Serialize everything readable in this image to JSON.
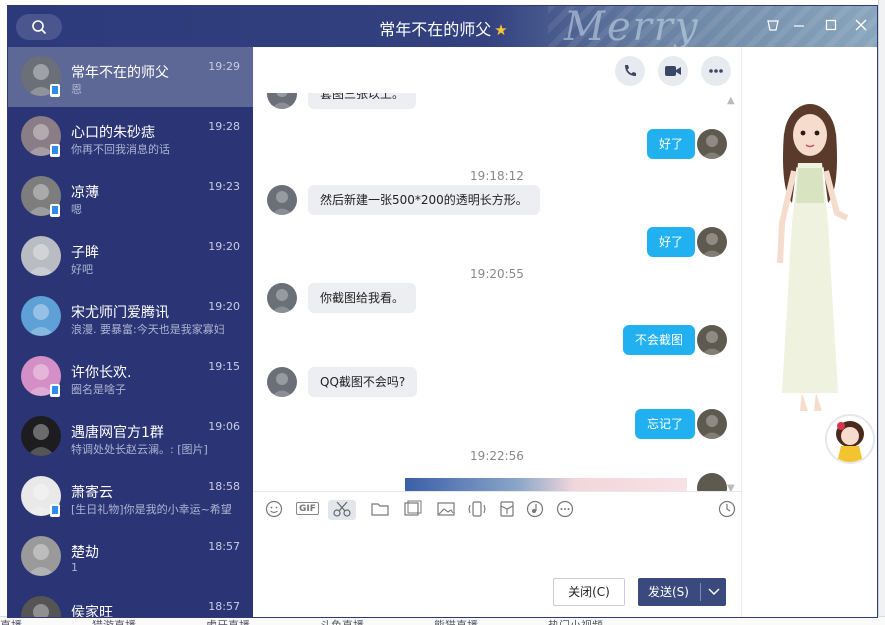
{
  "window": {
    "title": "常年不在的师父",
    "title_deco": "Merry"
  },
  "background": {
    "bottom_text": [
      "直播",
      "猎游直播",
      "虎牙直播",
      "斗鱼直播",
      "熊猫直播",
      "热门小视频"
    ]
  },
  "contacts": [
    {
      "name": "常年不在的师父",
      "time": "19:29",
      "msg": "恩",
      "phone": true,
      "active": true,
      "avatar_color": "#6b6f78"
    },
    {
      "name": "心口的朱砂痣",
      "time": "19:28",
      "msg": "你再不回我消息的话",
      "phone": true,
      "active": false,
      "avatar_color": "#8a7d86"
    },
    {
      "name": "凉薄",
      "time": "19:23",
      "msg": "嗯",
      "phone": true,
      "active": false,
      "avatar_color": "#7d7d7d"
    },
    {
      "name": "子眸",
      "time": "19:20",
      "msg": "好吧",
      "phone": false,
      "active": false,
      "avatar_color": "#b9bcc2"
    },
    {
      "name": "宋尤师门爱腾讯",
      "time": "19:20",
      "msg": "浪漫. 要暴富:今天也是我家寡妇",
      "phone": false,
      "active": false,
      "avatar_color": "#5fa0d6"
    },
    {
      "name": "许你长欢.",
      "time": "19:15",
      "msg": "圈名是啥子",
      "phone": true,
      "active": false,
      "avatar_color": "#d58fc7"
    },
    {
      "name": "遇唐网官方1群",
      "time": "19:06",
      "msg": "特调处处长赵云澜。: [图片]",
      "phone": false,
      "active": false,
      "avatar_color": "#1d1d1f"
    },
    {
      "name": "萧寄云",
      "time": "18:58",
      "msg": "[生日礼物]你是我的小幸运~希望",
      "phone": true,
      "active": false,
      "avatar_color": "#e9e9e9"
    },
    {
      "name": "楚劫",
      "time": "18:57",
      "msg": "1",
      "phone": false,
      "active": false,
      "avatar_color": "#9a9a9a"
    },
    {
      "name": "侯家旺",
      "time": "18:57",
      "msg": "",
      "phone": false,
      "active": false,
      "avatar_color": "#555"
    }
  ],
  "chat": {
    "messages": [
      {
        "type": "in",
        "text": "套图三张以上。"
      },
      {
        "type": "out",
        "text": "好了"
      },
      {
        "type": "time",
        "text": "19:18:12"
      },
      {
        "type": "in",
        "text": "然后新建一张500*200的透明长方形。"
      },
      {
        "type": "out",
        "text": "好了"
      },
      {
        "type": "time",
        "text": "19:20:55"
      },
      {
        "type": "in",
        "text": "你截图给我看。"
      },
      {
        "type": "out",
        "text": "不会截图"
      },
      {
        "type": "in",
        "text": "QQ截图不会吗?"
      },
      {
        "type": "out",
        "text": "忘记了"
      },
      {
        "type": "time",
        "text": "19:22:56"
      }
    ]
  },
  "toolbar": {
    "icons": [
      "emoji-icon",
      "gif-icon",
      "screenshot-icon",
      "folder-icon",
      "image-gallery-icon",
      "image-icon",
      "shake-icon",
      "red-packet-icon",
      "music-icon",
      "more-icon",
      "history-icon"
    ],
    "gif_label": "GIF"
  },
  "actions": {
    "close_label": "关闭(C)",
    "send_label": "发送(S)",
    "send_arrow": "∨"
  }
}
